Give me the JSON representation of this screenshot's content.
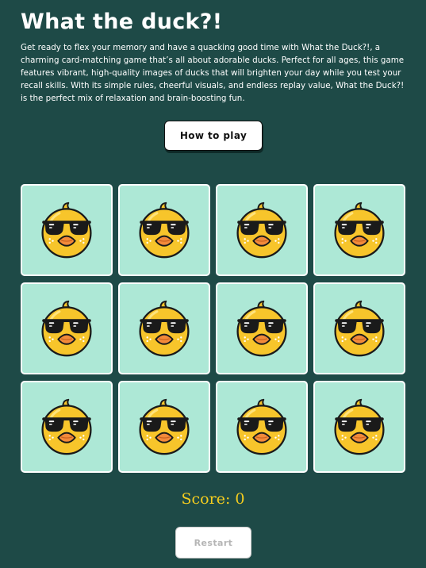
{
  "header": {
    "title": "What the duck?!",
    "description": "Get ready to flex your memory and have a quacking good time with What the Duck?!, a charming card-matching game that’s all about adorable ducks. Perfect for all ages, this game features vibrant, high-quality images of ducks that will brighten your day while you test your recall skills. With its simple rules, cheerful visuals, and endless replay value, What the Duck?! is the perfect mix of relaxation and brain-boosting fun."
  },
  "controls": {
    "how_to_play_label": "How to play",
    "restart_label": "Restart",
    "restart_enabled": false
  },
  "board": {
    "rows": 3,
    "columns": 4,
    "card_back_icon": "duck-with-sunglasses-icon",
    "cards": [
      {
        "state": "face-down"
      },
      {
        "state": "face-down"
      },
      {
        "state": "face-down"
      },
      {
        "state": "face-down"
      },
      {
        "state": "face-down"
      },
      {
        "state": "face-down"
      },
      {
        "state": "face-down"
      },
      {
        "state": "face-down"
      },
      {
        "state": "face-down"
      },
      {
        "state": "face-down"
      },
      {
        "state": "face-down"
      },
      {
        "state": "face-down"
      }
    ]
  },
  "score": {
    "label": "Score: 0",
    "value": 0
  },
  "colors": {
    "background": "#1e4a47",
    "card_face": "#ade8d6",
    "card_border": "#ffffff",
    "score_text": "#f5cd1f",
    "duck_body": "#f7c52b",
    "duck_beak": "#f28a3a",
    "sunglasses": "#1a1a1a"
  }
}
